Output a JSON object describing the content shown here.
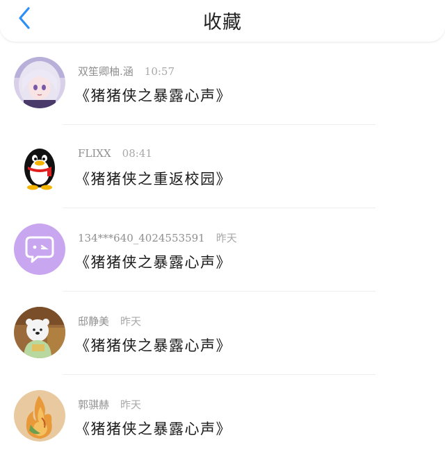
{
  "header": {
    "title": "收藏",
    "back_icon": "chevron-left-icon",
    "accent_color": "#2b8ff5"
  },
  "items": [
    {
      "name": "双笙卿柚.涵",
      "time": "10:57",
      "message": "《猪猪侠之暴露心声》",
      "avatar": "anime-girl-avatar"
    },
    {
      "name": "FLIXX",
      "time": "08:41",
      "message": "《猪猪侠之重返校园》",
      "avatar": "qq-penguin-avatar"
    },
    {
      "name": "134***640_4024553591",
      "time": "昨天",
      "message": "《猪猪侠之暴露心声》",
      "avatar": "chat-bubble-avatar"
    },
    {
      "name": "邸静美",
      "time": "昨天",
      "message": "《猪猪侠之暴露心声》",
      "avatar": "polar-bear-avatar"
    },
    {
      "name": "郭骐赫",
      "time": "昨天",
      "message": "《猪猪侠之暴露心声》",
      "avatar": "flame-avatar"
    }
  ]
}
